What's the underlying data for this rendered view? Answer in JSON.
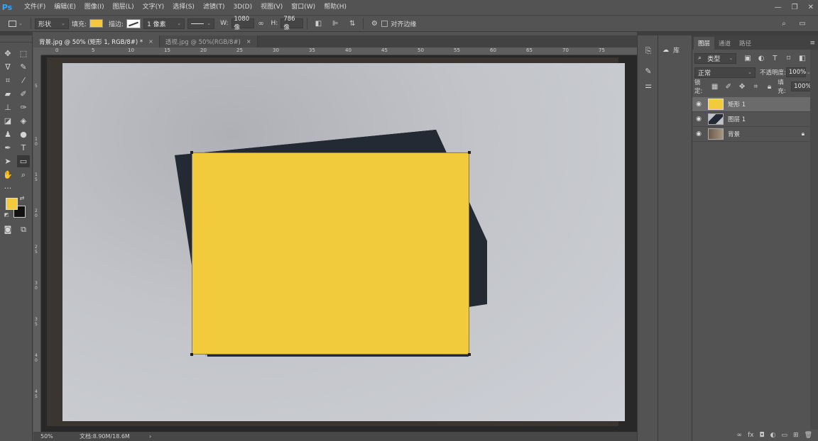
{
  "app": {
    "logo": "Ps"
  },
  "menu": [
    "文件(F)",
    "编辑(E)",
    "图像(I)",
    "图层(L)",
    "文字(Y)",
    "选择(S)",
    "滤镜(T)",
    "3D(D)",
    "视图(V)",
    "窗口(W)",
    "帮助(H)"
  ],
  "window_controls": [
    "—",
    "❐",
    "✕"
  ],
  "options": {
    "mode": "形状",
    "fill_label": "填充:",
    "fill_color": "#f2cb3c",
    "stroke_label": "描边:",
    "stroke_width": "1 像素",
    "width_label": "W:",
    "width_value": "1080 像",
    "height_label": "H:",
    "height_value": "786 像",
    "align_edges": "对齐边缘"
  },
  "tabs": [
    {
      "label": "背景.jpg @ 50% (矩形 1, RGB/8#) *",
      "close": "×"
    },
    {
      "label": "透视.jpg @ 50%(RGB/8#)",
      "close": "×"
    }
  ],
  "ruler_top": [
    "0",
    "5",
    "10",
    "15",
    "20",
    "25",
    "30",
    "35",
    "40",
    "45",
    "50",
    "55",
    "60",
    "65",
    "70",
    "75"
  ],
  "ruler_left": [
    "5",
    "1 0",
    "1 5",
    "2 0",
    "2 5",
    "3 0",
    "3 5",
    "4 0",
    "4 5"
  ],
  "status": {
    "zoom": "50%",
    "doc": "文档:8.90M/18.6M",
    "arrow": "›"
  },
  "midbar": {
    "library_label": "库"
  },
  "layers_panel": {
    "tabs": [
      "图层",
      "通道",
      "路径"
    ],
    "filter": "类型",
    "blend_mode": "正常",
    "opacity_label": "不透明度:",
    "opacity": "100%",
    "lock_label": "锁定:",
    "fill_label": "填充:",
    "fill": "100%",
    "layers": [
      {
        "name": "矩形 1",
        "selected": true
      },
      {
        "name": "图层 1",
        "selected": false
      },
      {
        "name": "背景",
        "selected": false,
        "locked": true
      }
    ]
  },
  "colors": {
    "accent_yellow": "#f2cb3c",
    "dark_paper": "#232a33"
  }
}
